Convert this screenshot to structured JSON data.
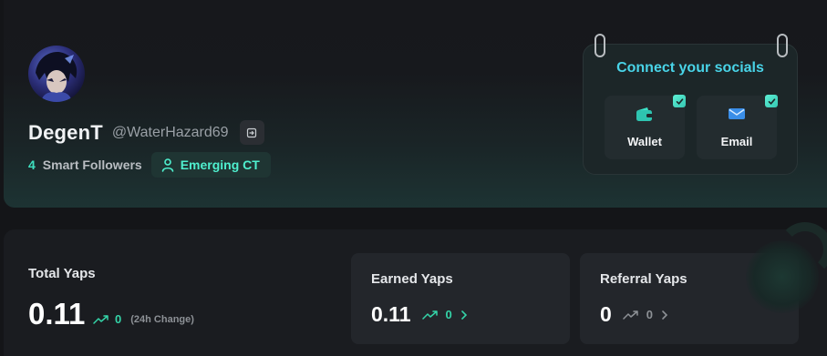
{
  "profile": {
    "display_name": "DegenT",
    "handle": "@WaterHazard69",
    "smart_followers_count": "4",
    "smart_followers_label": "Smart Followers",
    "badge_label": "Emerging CT"
  },
  "socials": {
    "title": "Connect your socials",
    "items": [
      {
        "label": "Wallet",
        "icon": "wallet-icon",
        "connected": true
      },
      {
        "label": "Email",
        "icon": "email-icon",
        "connected": true
      }
    ]
  },
  "yaps": {
    "total_label": "Total Yaps",
    "total_value": "0.11",
    "total_change": "0",
    "total_change_label": "(24h Change)",
    "earned_label": "Earned Yaps",
    "earned_value": "0.11",
    "earned_change": "0",
    "referral_label": "Referral Yaps",
    "referral_value": "0",
    "referral_change": "0"
  },
  "colors": {
    "accent_teal": "#3fe0c0",
    "accent_cyan": "#49d4e8",
    "change_green": "#34d4a8",
    "change_gray": "#8d9196"
  }
}
